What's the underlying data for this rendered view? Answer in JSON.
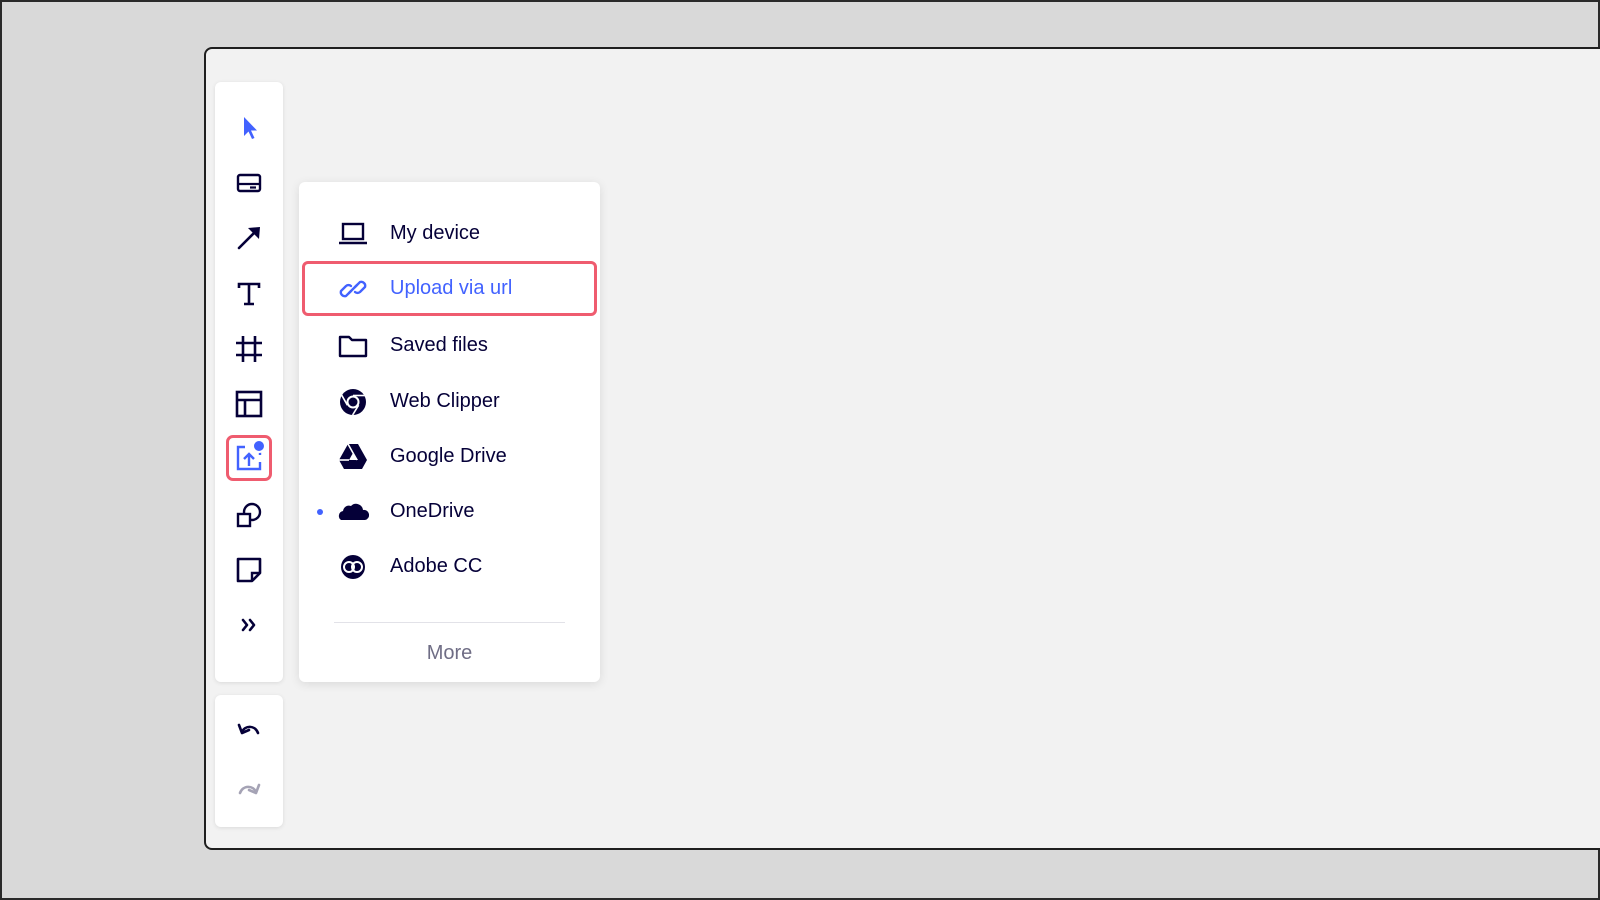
{
  "colors": {
    "accent": "#4262ff",
    "highlight": "#ef5c6f",
    "ink": "#050038",
    "muted": "#6f6d85",
    "canvas": "#f2f2f2"
  },
  "toolbar": {
    "tools": [
      {
        "name": "select",
        "icon": "cursor-icon"
      },
      {
        "name": "card",
        "icon": "card-icon"
      },
      {
        "name": "line",
        "icon": "arrow-icon"
      },
      {
        "name": "text",
        "icon": "text-icon"
      },
      {
        "name": "frame",
        "icon": "frame-icon"
      },
      {
        "name": "templates",
        "icon": "template-icon"
      },
      {
        "name": "upload",
        "icon": "upload-icon",
        "active": true
      },
      {
        "name": "shapes",
        "icon": "shapes-icon"
      },
      {
        "name": "sticky-note",
        "icon": "sticky-note-icon"
      },
      {
        "name": "more-tools",
        "icon": "double-chevron-right-icon"
      }
    ],
    "undo_icon": "undo-icon",
    "redo_icon": "redo-icon"
  },
  "upload_menu": {
    "items": [
      {
        "label": "My device",
        "icon": "laptop-icon"
      },
      {
        "label": "Upload via url",
        "icon": "link-icon",
        "highlighted": true
      },
      {
        "label": "Saved files",
        "icon": "folder-icon"
      },
      {
        "label": "Web Clipper",
        "icon": "chrome-icon"
      },
      {
        "label": "Google Drive",
        "icon": "google-drive-icon"
      },
      {
        "label": "OneDrive",
        "icon": "onedrive-icon",
        "new_indicator": true
      },
      {
        "label": "Adobe CC",
        "icon": "adobe-cc-icon"
      }
    ],
    "more_label": "More"
  }
}
